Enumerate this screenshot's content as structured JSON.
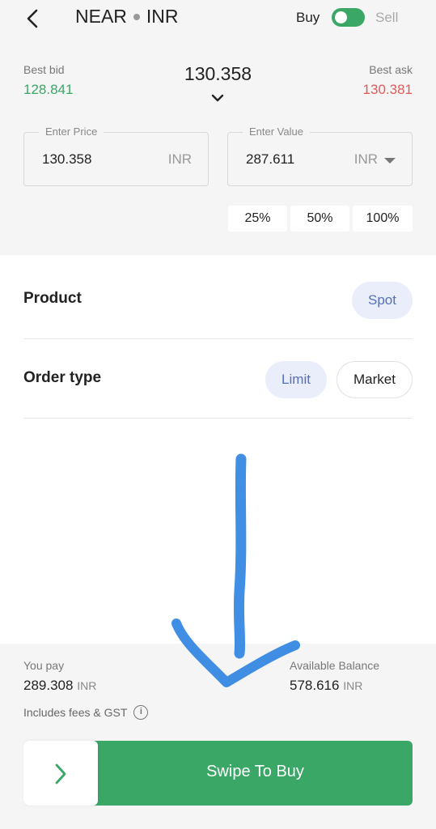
{
  "header": {
    "base": "NEAR",
    "quote": "INR",
    "buy_label": "Buy",
    "sell_label": "Sell",
    "buy_selected": true
  },
  "market": {
    "best_bid_label": "Best bid",
    "best_bid": "128.841",
    "best_ask_label": "Best ask",
    "best_ask": "130.381",
    "last_price": "130.358"
  },
  "price_field": {
    "label": "Enter Price",
    "value": "130.358",
    "unit": "INR"
  },
  "value_field": {
    "label": "Enter Value",
    "value": "287.611",
    "unit": "INR"
  },
  "percent_buttons": [
    "25%",
    "50%",
    "100%"
  ],
  "product": {
    "label": "Product",
    "option": "Spot"
  },
  "order_type": {
    "label": "Order type",
    "options": [
      "Limit",
      "Market"
    ],
    "selected": "Limit"
  },
  "summary": {
    "pay_label": "You pay",
    "pay_value": "289.308",
    "pay_unit": "INR",
    "balance_label": "Available Balance",
    "balance_value": "578.616",
    "balance_unit": "INR",
    "fees_note": "Includes fees & GST",
    "info_glyph": "i"
  },
  "swipe": {
    "label": "Swipe To Buy"
  },
  "colors": {
    "green": "#3aa767",
    "red": "#e05a5a",
    "accent_blue": "#5670b8",
    "annotation_arrow": "#1e7be0"
  },
  "icons": {
    "back": "chevron-left-icon",
    "price_selector": "chevron-down-icon",
    "currency_dropdown": "caret-down-icon",
    "info": "info-icon",
    "swipe_handle": "chevron-right-icon"
  }
}
